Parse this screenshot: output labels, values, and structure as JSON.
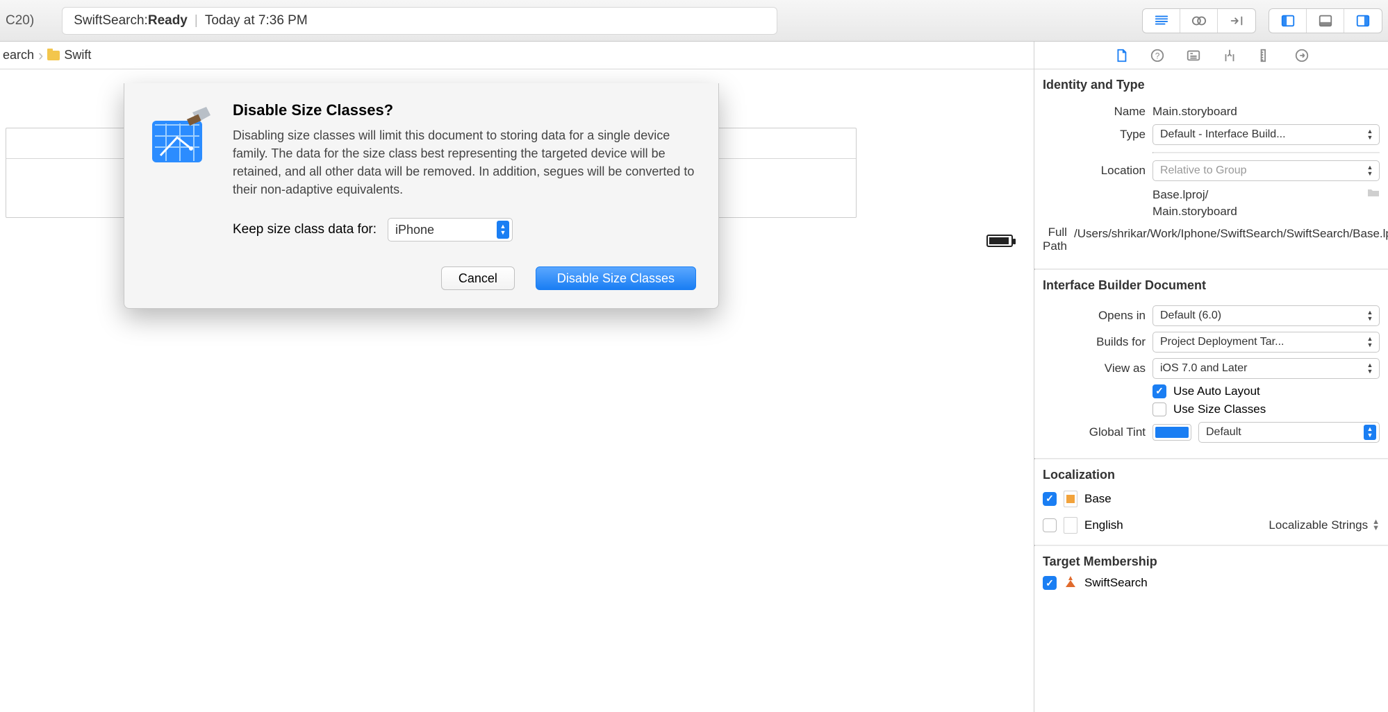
{
  "toolbar": {
    "left_fragment": "C20)",
    "status_app": "SwiftSearch: ",
    "status_state": "Ready",
    "status_time": "Today at 7:36 PM"
  },
  "breadcrumb": {
    "item0": "earch",
    "item1": "Swift"
  },
  "dialog": {
    "title": "Disable Size Classes?",
    "description": "Disabling size classes will limit this document to storing data for a single device family. The data for the size class best representing the targeted device will be retained, and all other data will be removed. In addition, segues will be converted to their non-adaptive equivalents.",
    "keep_label": "Keep size class data for:",
    "keep_value": "iPhone",
    "cancel": "Cancel",
    "confirm": "Disable Size Classes"
  },
  "inspector": {
    "identity": {
      "header": "Identity and Type",
      "name_label": "Name",
      "name_value": "Main.storyboard",
      "type_label": "Type",
      "type_value": "Default - Interface Build...",
      "location_label": "Location",
      "location_value": "Relative to Group",
      "location_path": "Base.lproj/\nMain.storyboard",
      "fullpath_label": "Full Path",
      "fullpath_value": "/Users/shrikar/Work/Iphone/SwiftSearch/SwiftSearch/Base.lproj/Main.storyboard"
    },
    "ibdoc": {
      "header": "Interface Builder Document",
      "opensin_label": "Opens in",
      "opensin_value": "Default (6.0)",
      "buildsfor_label": "Builds for",
      "buildsfor_value": "Project Deployment Tar...",
      "viewas_label": "View as",
      "viewas_value": "iOS 7.0 and Later",
      "use_autolayout": "Use Auto Layout",
      "use_sizeclasses": "Use Size Classes",
      "globaltint_label": "Global Tint",
      "globaltint_value": "Default"
    },
    "localization": {
      "header": "Localization",
      "base": "Base",
      "english": "English",
      "english_strings": "Localizable Strings"
    },
    "target": {
      "header": "Target Membership",
      "item0": "SwiftSearch"
    }
  }
}
